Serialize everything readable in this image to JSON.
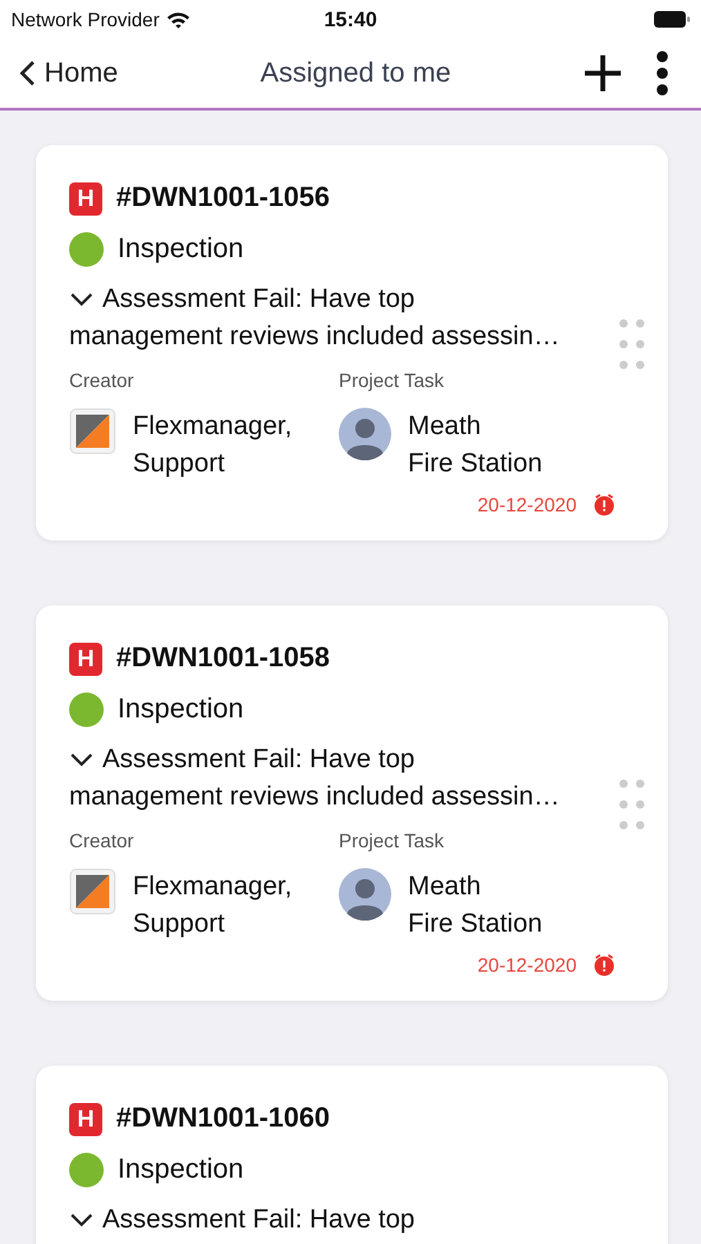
{
  "status_bar": {
    "carrier": "Network Provider",
    "time": "15:40"
  },
  "nav": {
    "back": "Home",
    "title": "Assigned to me"
  },
  "tasks": [
    {
      "priority": "H",
      "id": "#DWN1001-1056",
      "type": {
        "label": "Inspection",
        "color": "#7cb82f"
      },
      "description": [
        "Assessment Fail: Have top",
        "management reviews included assessin…"
      ],
      "creator": {
        "label": "Creator",
        "name": [
          "Flexmanager,",
          "Support"
        ]
      },
      "project": {
        "label": "Project Task",
        "name": [
          "Meath",
          "Fire Station"
        ]
      },
      "due": "20-12-2020",
      "overdue": true
    },
    {
      "priority": "H",
      "id": "#DWN1001-1058",
      "type": {
        "label": "Inspection",
        "color": "#7cb82f"
      },
      "description": [
        "Assessment Fail: Have top",
        "management reviews included assessin…"
      ],
      "creator": {
        "label": "Creator",
        "name": [
          "Flexmanager,",
          "Support"
        ]
      },
      "project": {
        "label": "Project Task",
        "name": [
          "Meath",
          "Fire Station"
        ]
      },
      "due": "20-12-2020",
      "overdue": true
    },
    {
      "priority": "H",
      "id": "#DWN1001-1060",
      "type": {
        "label": "Inspection",
        "color": "#7cb82f"
      },
      "description": [
        "Assessment Fail: Have top"
      ]
    }
  ]
}
